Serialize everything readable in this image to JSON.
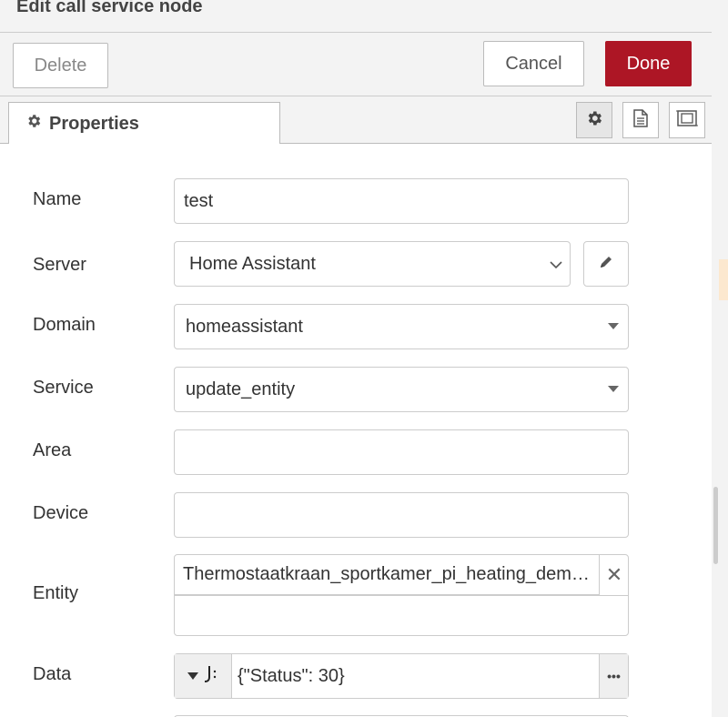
{
  "header": {
    "title": "Edit call service node"
  },
  "toolbar": {
    "delete_label": "Delete",
    "cancel_label": "Cancel",
    "done_label": "Done"
  },
  "tabs": {
    "properties_label": "Properties"
  },
  "tool_icons": [
    "gear-icon",
    "description-icon",
    "appearance-icon"
  ],
  "form": {
    "name": {
      "label": "Name",
      "value": "test"
    },
    "server": {
      "label": "Server",
      "value": "Home Assistant"
    },
    "domain": {
      "label": "Domain",
      "value": "homeassistant"
    },
    "service": {
      "label": "Service",
      "value": "update_entity"
    },
    "area": {
      "label": "Area",
      "value": ""
    },
    "device": {
      "label": "Device",
      "value": ""
    },
    "entity": {
      "label": "Entity",
      "value": "Thermostaatkraan_sportkamer_pi_heating_demand"
    },
    "data": {
      "label": "Data",
      "value": "{\"Status\": 30}"
    }
  },
  "colors": {
    "done": "#ad1625",
    "accent": "#fce8cf"
  }
}
